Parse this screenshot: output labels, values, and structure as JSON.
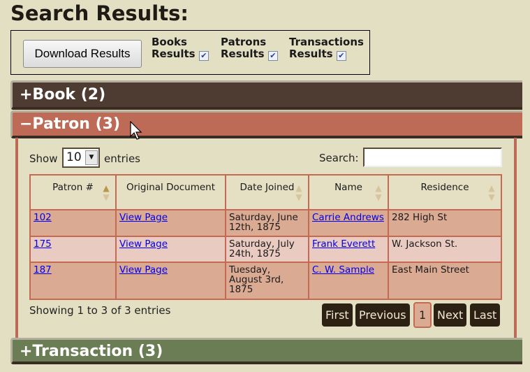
{
  "title": "Search Results:",
  "download": {
    "button": "Download Results",
    "options": [
      {
        "line1": "Books",
        "line2": "Results",
        "checked": true
      },
      {
        "line1": "Patrons",
        "line2": "Results",
        "checked": true
      },
      {
        "line1": "Transactions",
        "line2": "Results",
        "checked": true
      }
    ]
  },
  "sections": {
    "book": "+Book (2)",
    "patron": "−Patron (3)",
    "transaction": "+Transaction (3)"
  },
  "colors": {
    "book": "#4e3b32",
    "patron": "#bd6b56",
    "transaction": "#6b7d55"
  },
  "table": {
    "show": "Show",
    "entries_value": "10",
    "entries": "entries",
    "search_label": "Search:",
    "search_value": "",
    "headers": [
      "Patron #",
      "Original Document",
      "Date Joined",
      "Name",
      "Residence"
    ],
    "rows": [
      {
        "id": "102",
        "doc": "View Page",
        "date": "Saturday, June 12th, 1875",
        "name": "Carrie Andrews",
        "residence": "282 High St"
      },
      {
        "id": "175",
        "doc": "View Page",
        "date": "Saturday, July 24th, 1875",
        "name": "Frank Everett",
        "residence": "W. Jackson St."
      },
      {
        "id": "187",
        "doc": "View Page",
        "date": "Tuesday, August 3rd, 1875",
        "name": "C. W. Sample",
        "residence": "East Main Street"
      }
    ],
    "info": "Showing 1 to 3 of 3 entries",
    "pagination": {
      "first": "First",
      "previous": "Previous",
      "current": "1",
      "next": "Next",
      "last": "Last"
    }
  }
}
